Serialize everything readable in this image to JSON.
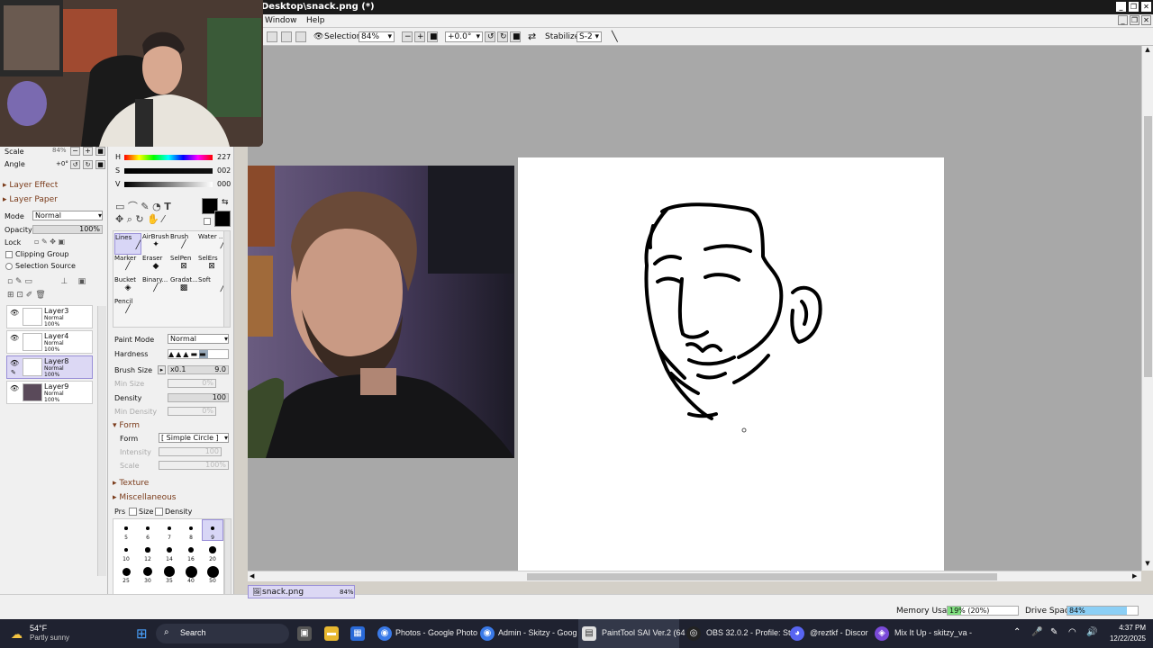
{
  "window": {
    "title": "Desktop\\snack.png (*)"
  },
  "menu": {
    "window": "Window",
    "help": "Help"
  },
  "toolbar": {
    "selection_label": "Selection",
    "zoom": "84%",
    "rotation": "+0.0°",
    "stabilizer_label": "Stabilizer",
    "stabilizer_value": "S-2"
  },
  "navigator": {
    "scale_label": "Scale",
    "scale_value": "84%",
    "angle_label": "Angle",
    "angle_value": "+0°"
  },
  "layer_panel": {
    "layer_effect": "Layer Effect",
    "layer_paper": "Layer Paper",
    "mode_label": "Mode",
    "mode_value": "Normal",
    "opacity_label": "Opacity",
    "opacity_value": "100%",
    "lock_label": "Lock",
    "clipping_group": "Clipping Group",
    "selection_source": "Selection Source",
    "layers": [
      {
        "name": "Layer3",
        "mode": "Normal",
        "opacity": "100%"
      },
      {
        "name": "Layer4",
        "mode": "Normal",
        "opacity": "100%"
      },
      {
        "name": "Layer8",
        "mode": "Normal",
        "opacity": "100%"
      },
      {
        "name": "Layer9",
        "mode": "Normal",
        "opacity": "100%"
      }
    ]
  },
  "color": {
    "h_label": "H",
    "h_value": "227",
    "s_label": "S",
    "s_value": "002",
    "v_label": "V",
    "v_value": "000"
  },
  "tools": {
    "items": [
      {
        "label": "Lines"
      },
      {
        "label": "AirBrush"
      },
      {
        "label": "Brush"
      },
      {
        "label": "Water ..."
      },
      {
        "label": "Marker"
      },
      {
        "label": "Eraser"
      },
      {
        "label": "SelPen"
      },
      {
        "label": "SelErs"
      },
      {
        "label": "Bucket"
      },
      {
        "label": "Binary..."
      },
      {
        "label": "Gradat..."
      },
      {
        "label": "Soft"
      },
      {
        "label": "Pencil"
      }
    ]
  },
  "brush": {
    "paint_mode_label": "Paint Mode",
    "paint_mode_value": "Normal",
    "hardness_label": "Hardness",
    "brush_size_label": "Brush Size",
    "brush_size_mult": "x0.1",
    "brush_size_value": "9.0",
    "min_size_label": "Min Size",
    "min_size_value": "0%",
    "density_label": "Density",
    "density_value": "100",
    "min_density_label": "Min Density",
    "min_density_value": "0%",
    "form_section": "Form",
    "form_label": "Form",
    "form_value": "[ Simple Circle ]",
    "intensity_label": "Intensity",
    "intensity_value": "100",
    "scale_label": "Scale",
    "scale_value": "100%",
    "texture_section": "Texture",
    "misc_section": "Miscellaneous",
    "prs_label": "Prs",
    "prs_size": "Size",
    "prs_density": "Density",
    "sizes": [
      "5",
      "6",
      "7",
      "8",
      "9",
      "10",
      "12",
      "14",
      "16",
      "20",
      "25",
      "30",
      "35",
      "40",
      "50"
    ]
  },
  "document_tab": {
    "name": "snack.png",
    "zoom": "84%"
  },
  "status": {
    "memory_label": "Memory Usage",
    "memory_value": "19% (20%)",
    "memory_fraction": 0.19,
    "drive_label": "Drive Space",
    "drive_value": "84%",
    "drive_fraction": 0.84
  },
  "taskbar": {
    "weather_temp": "54°F",
    "weather_desc": "Partly sunny",
    "search": "Search",
    "apps": [
      {
        "label": "Photos - Google Photo"
      },
      {
        "label": "Admin - Skitzy - Goog"
      },
      {
        "label": "PaintTool SAI Ver.2 (64"
      },
      {
        "label": "OBS 32.0.2 - Profile: St"
      },
      {
        "label": "@reztkf - Discor"
      },
      {
        "label": "Mix It Up - skitzy_va - "
      }
    ],
    "time": "4:37 PM",
    "date": "12/22/2025"
  }
}
